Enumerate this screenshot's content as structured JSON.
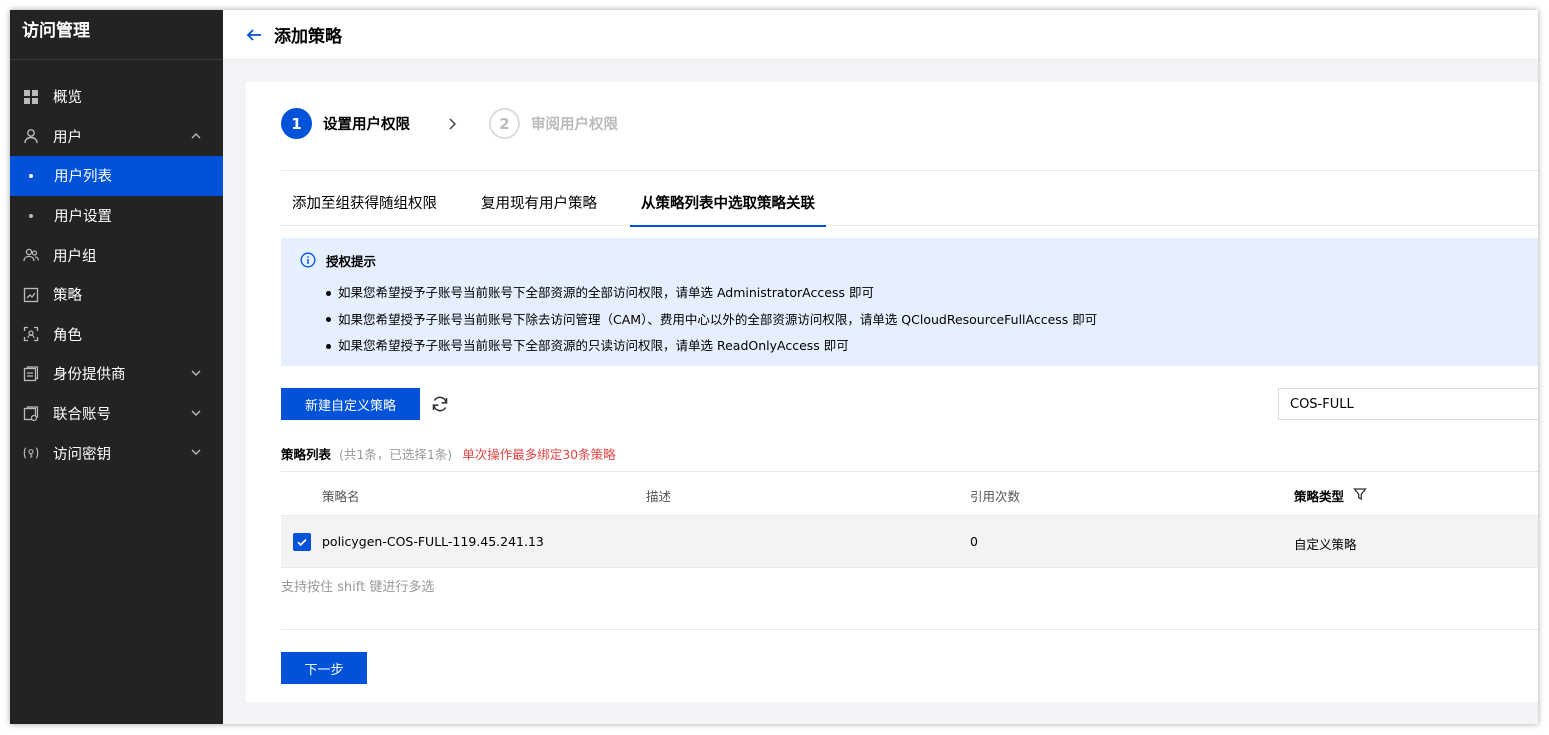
{
  "sidebar": {
    "title": "访问管理",
    "items": [
      {
        "label": "概览",
        "icon": "grid-icon"
      },
      {
        "label": "用户",
        "icon": "user-icon"
      },
      {
        "label": "用户列表"
      },
      {
        "label": "用户设置"
      },
      {
        "label": "用户组",
        "icon": "user-group-icon"
      },
      {
        "label": "策略",
        "icon": "policy-icon"
      },
      {
        "label": "角色",
        "icon": "role-icon"
      },
      {
        "label": "身份提供商",
        "icon": "identity-provider-icon"
      },
      {
        "label": "联合账号",
        "icon": "federated-account-icon"
      },
      {
        "label": "访问密钥",
        "icon": "access-key-icon"
      }
    ]
  },
  "header": {
    "title": "添加策略"
  },
  "steps": [
    {
      "number": "1",
      "label": "设置用户权限",
      "active": true
    },
    {
      "number": "2",
      "label": "审阅用户权限",
      "active": false
    }
  ],
  "tabs": [
    {
      "label": "添加至组获得随组权限"
    },
    {
      "label": "复用现有用户策略"
    },
    {
      "label": "从策略列表中选取策略关联"
    }
  ],
  "notice": {
    "title": "授权提示",
    "items": [
      "如果您希望授予子账号当前账号下全部资源的全部访问权限，请单选 AdministratorAccess 即可",
      "如果您希望授予子账号当前账号下除去访问管理（CAM）、费用中心以外的全部资源访问权限，请单选 QCloudResourceFullAccess 即可",
      "如果您希望授予子账号当前账号下全部资源的只读访问权限，请单选 ReadOnlyAccess 即可"
    ]
  },
  "toolbar": {
    "new_policy_label": "新建自定义策略",
    "search_value": "COS-FULL"
  },
  "list": {
    "title": "策略列表",
    "count_text": "(共1条，已选择1条)",
    "limit_text": "单次操作最多绑定30条策略"
  },
  "table": {
    "columns": [
      "策略名",
      "描述",
      "引用次数",
      "策略类型"
    ],
    "rows": [
      {
        "name": "policygen-COS-FULL-119.45.241.13",
        "description": "",
        "references": "0",
        "type": "自定义策略",
        "checked": true
      }
    ]
  },
  "hint": "支持按住 shift 键进行多选",
  "footer": {
    "next_label": "下一步"
  },
  "colors": {
    "primary": "#0052d9",
    "sidebar_bg": "#232323",
    "notice_bg": "#e6efff",
    "warning": "#e54545"
  }
}
